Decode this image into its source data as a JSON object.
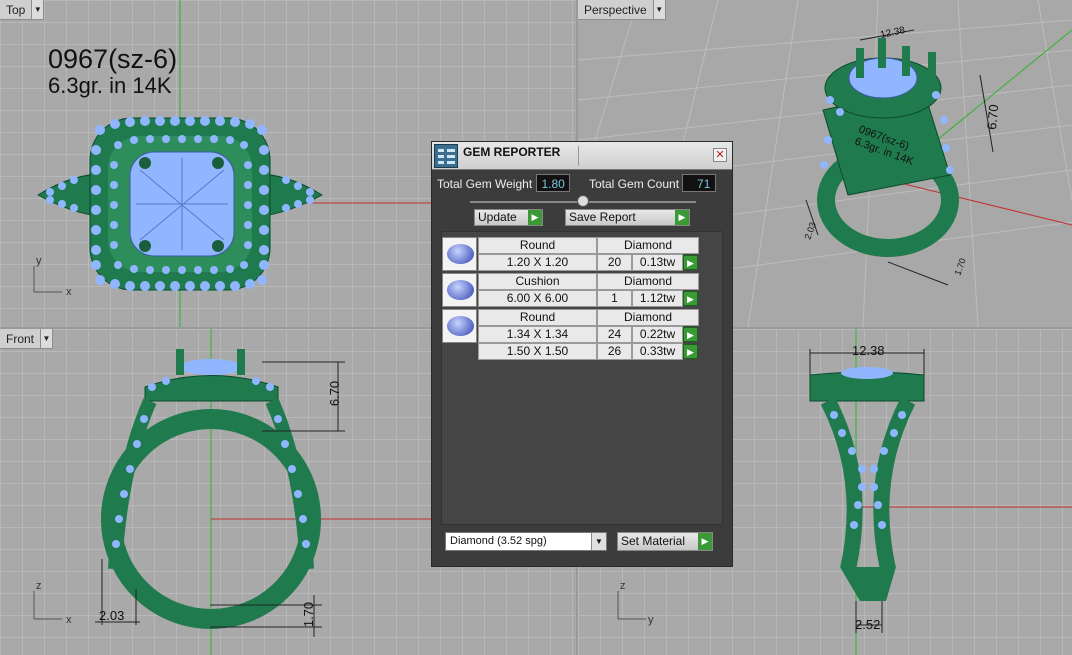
{
  "viewports": {
    "top": {
      "label": "Top"
    },
    "perspective": {
      "label": "Perspective"
    },
    "front": {
      "label": "Front"
    },
    "right": {
      "label": ""
    }
  },
  "model_label": {
    "line1": "0967(sz-6)",
    "line2": "6.3gr.  in 14K"
  },
  "dimensions": {
    "front_height": "6.70",
    "front_width": "2.03",
    "front_bottom": "1.70",
    "right_top": "12.38",
    "right_bottom": "2.52",
    "persp_top": "12.38",
    "persp_height": "6.70",
    "persp_side": "2.03",
    "persp_bottom": "1.70",
    "persp_label1": "0967(sz-6)",
    "persp_label2": "6.3gr. in 14K"
  },
  "axes": {
    "x": "x",
    "y": "y",
    "z": "z"
  },
  "gem_reporter": {
    "title": "GEM REPORTER",
    "close_icon": "close-icon",
    "total_weight_label": "Total Gem Weight",
    "total_weight_value": "1.80",
    "total_count_label": "Total Gem Count",
    "total_count_value": "71",
    "update_label": "Update",
    "save_report_label": "Save Report",
    "groups": [
      {
        "shape": "Round",
        "material": "Diamond",
        "rows": [
          {
            "size": "1.20 X 1.20",
            "count": "20",
            "weight": "0.13tw"
          }
        ]
      },
      {
        "shape": "Cushion",
        "material": "Diamond",
        "rows": [
          {
            "size": "6.00 X 6.00",
            "count": "1",
            "weight": "1.12tw"
          }
        ]
      },
      {
        "shape": "Round",
        "material": "Diamond",
        "rows": [
          {
            "size": "1.34 X 1.34",
            "count": "24",
            "weight": "0.22tw"
          },
          {
            "size": "1.50 X 1.50",
            "count": "26",
            "weight": "0.33tw"
          }
        ]
      }
    ],
    "material_select": "Diamond    (3.52 spg)",
    "set_material_label": "Set Material"
  },
  "colors": {
    "metal": "#1f7a4e",
    "gem": "#8fb6ff",
    "grid": "#a9a9a9",
    "accent_green": "#3a9a36"
  }
}
